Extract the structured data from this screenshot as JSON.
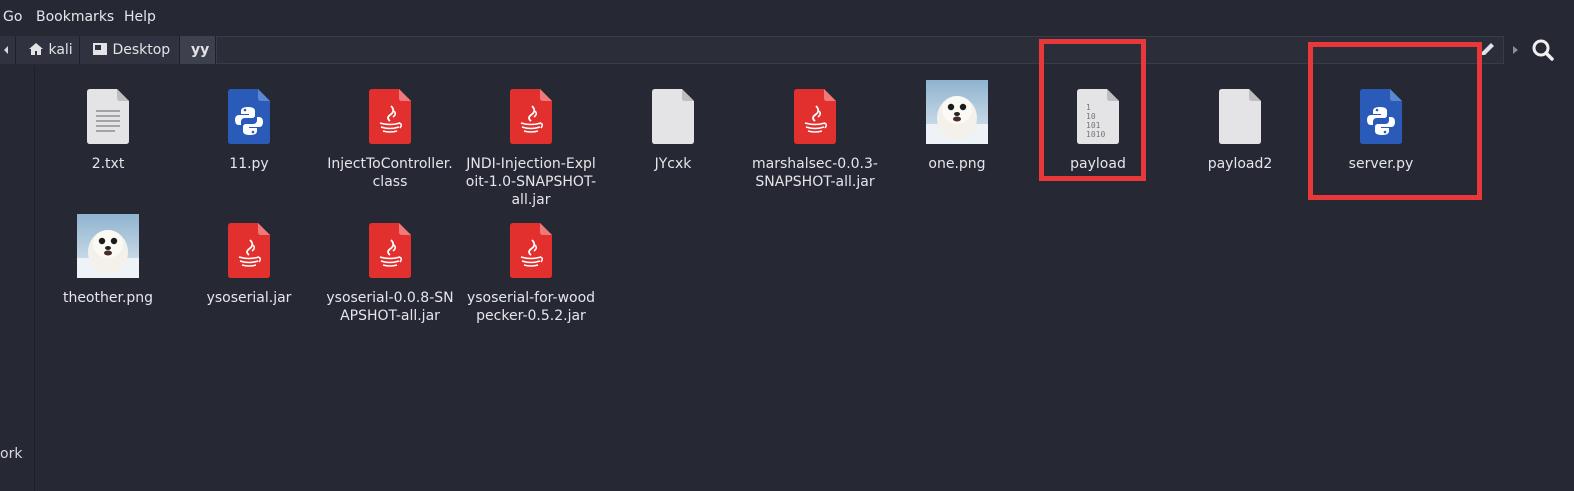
{
  "menubar": {
    "go": "Go",
    "bookmarks": "Bookmarks",
    "help": "Help"
  },
  "pathbar": {
    "segments": [
      {
        "label": "kali",
        "icon": "home-icon"
      },
      {
        "label": "Desktop",
        "icon": "desktop-icon"
      },
      {
        "label": "yy"
      }
    ]
  },
  "sidebar": {
    "fragment": "ork"
  },
  "files": [
    {
      "name": "2.txt",
      "type": "text-file-icon"
    },
    {
      "name": "11.py",
      "type": "python-file-icon"
    },
    {
      "name": "InjectToController.class",
      "type": "java-file-icon"
    },
    {
      "name": "JNDI-Injection-Exploit-1.0-SNAPSHOT-all.jar",
      "type": "java-file-icon"
    },
    {
      "name": "JYcxk",
      "type": "generic-file-icon"
    },
    {
      "name": "marshalsec-0.0.3-SNAPSHOT-all.jar",
      "type": "java-file-icon"
    },
    {
      "name": "one.png",
      "type": "image-thumbnail-icon"
    },
    {
      "name": "payload",
      "type": "binary-file-icon"
    },
    {
      "name": "payload2",
      "type": "generic-file-icon"
    },
    {
      "name": "server.py",
      "type": "python-file-icon"
    },
    {
      "name": "theother.png",
      "type": "image-thumbnail-icon"
    },
    {
      "name": "ysoserial.jar",
      "type": "java-file-icon"
    },
    {
      "name": "ysoserial-0.0.8-SNAPSHOT-all.jar",
      "type": "java-file-icon"
    },
    {
      "name": "ysoserial-for-woodpecker-0.5.2.jar",
      "type": "java-file-icon"
    }
  ],
  "binary_icon_text": [
    "1",
    "10",
    "101",
    "1010"
  ],
  "colors": {
    "background": "#262833",
    "highlight": "#e8383a",
    "java": "#e2302f",
    "python": "#2a5bb8",
    "text_doc": "#e4e4e6"
  }
}
